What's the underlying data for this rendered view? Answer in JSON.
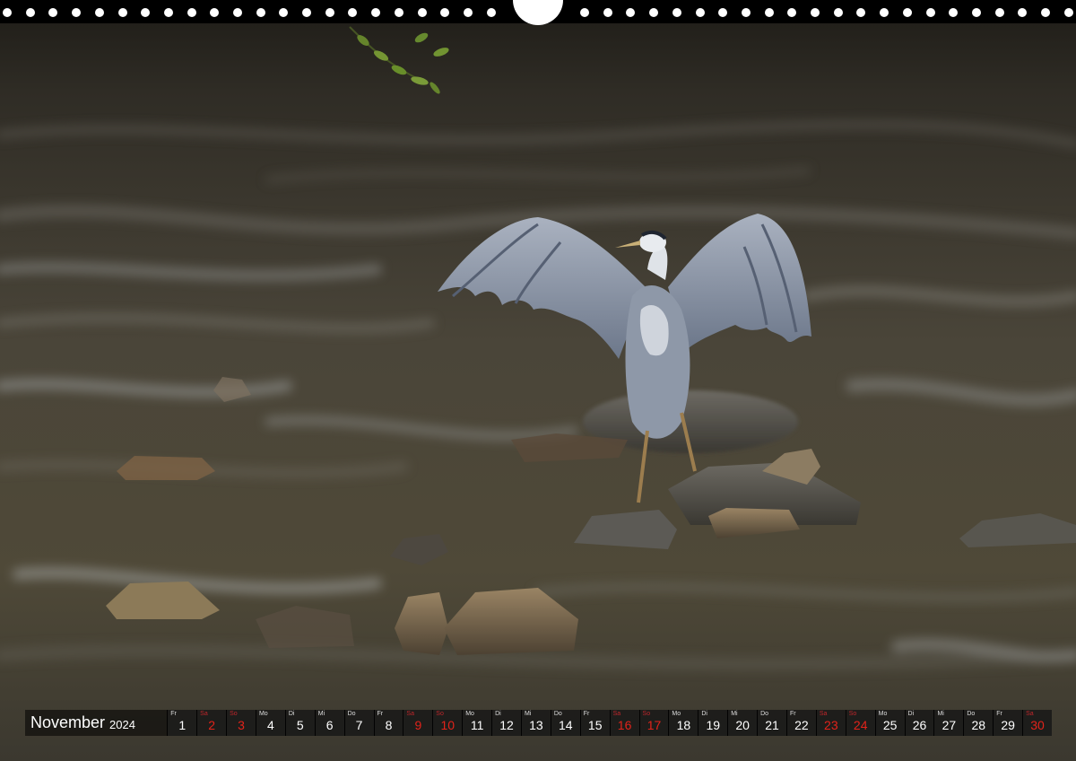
{
  "calendar": {
    "month": "November",
    "year": "2024",
    "days": [
      {
        "wd": "Fr",
        "num": "1",
        "red": false
      },
      {
        "wd": "Sa",
        "num": "2",
        "red": true
      },
      {
        "wd": "So",
        "num": "3",
        "red": true
      },
      {
        "wd": "Mo",
        "num": "4",
        "red": false
      },
      {
        "wd": "Di",
        "num": "5",
        "red": false
      },
      {
        "wd": "Mi",
        "num": "6",
        "red": false
      },
      {
        "wd": "Do",
        "num": "7",
        "red": false
      },
      {
        "wd": "Fr",
        "num": "8",
        "red": false
      },
      {
        "wd": "Sa",
        "num": "9",
        "red": true
      },
      {
        "wd": "So",
        "num": "10",
        "red": true
      },
      {
        "wd": "Mo",
        "num": "11",
        "red": false
      },
      {
        "wd": "Di",
        "num": "12",
        "red": false
      },
      {
        "wd": "Mi",
        "num": "13",
        "red": false
      },
      {
        "wd": "Do",
        "num": "14",
        "red": false
      },
      {
        "wd": "Fr",
        "num": "15",
        "red": false
      },
      {
        "wd": "Sa",
        "num": "16",
        "red": true
      },
      {
        "wd": "So",
        "num": "17",
        "red": true
      },
      {
        "wd": "Mo",
        "num": "18",
        "red": false
      },
      {
        "wd": "Di",
        "num": "19",
        "red": false
      },
      {
        "wd": "Mi",
        "num": "20",
        "red": false
      },
      {
        "wd": "Do",
        "num": "21",
        "red": false
      },
      {
        "wd": "Fr",
        "num": "22",
        "red": false
      },
      {
        "wd": "Sa",
        "num": "23",
        "red": true
      },
      {
        "wd": "So",
        "num": "24",
        "red": true
      },
      {
        "wd": "Mo",
        "num": "25",
        "red": false
      },
      {
        "wd": "Di",
        "num": "26",
        "red": false
      },
      {
        "wd": "Mi",
        "num": "27",
        "red": false
      },
      {
        "wd": "Do",
        "num": "28",
        "red": false
      },
      {
        "wd": "Fr",
        "num": "29",
        "red": false
      },
      {
        "wd": "Sa",
        "num": "30",
        "red": true
      }
    ]
  },
  "colors": {
    "weekend_red": "#e2231a",
    "water_dark": "#3e3a33",
    "heron_grey": "#8e98a8"
  }
}
